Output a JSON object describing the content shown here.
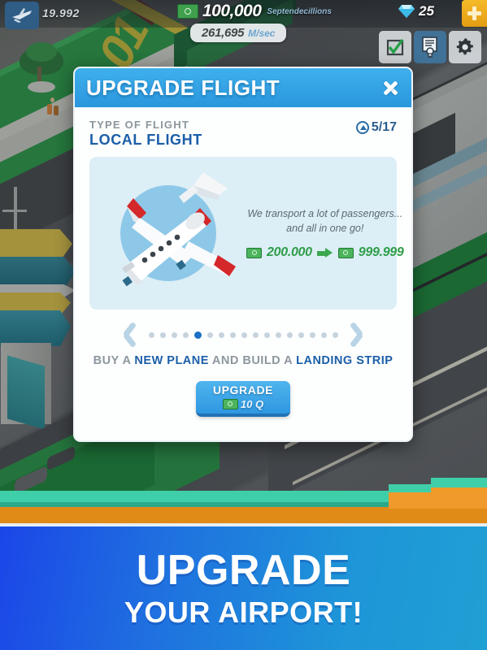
{
  "hud": {
    "plane_icon": "airplane-icon",
    "plane_count": "19.992",
    "cash_icon": "cash-icon",
    "money_value": "100,000",
    "money_unit": "Septendecillions",
    "rate_value": "261,695",
    "rate_unit": "M/sec",
    "gem_icon": "gem-icon",
    "gem_count": "25",
    "plus_icon": "plus-icon",
    "buttons": [
      {
        "name": "tasks-button",
        "icon": "checkmark-box-icon"
      },
      {
        "name": "missions-button",
        "icon": "certificate-icon"
      },
      {
        "name": "settings-button",
        "icon": "gear-icon"
      }
    ]
  },
  "modal": {
    "title": "UPGRADE FLIGHT",
    "close_icon": "close-icon",
    "type_label": "TYPE OF FLIGHT",
    "type_name": "LOCAL FLIGHT",
    "level_icon": "level-up-icon",
    "level_text": "5/17",
    "plane_art": "private-jet-illustration",
    "desc_line1": "We transport a lot of passengers...",
    "desc_line2": "and all in one go!",
    "cost_current": "200.000",
    "cost_next": "999.999",
    "arrow_icon": "arrow-right-icon",
    "prev_icon": "chevron-left-icon",
    "next_icon": "chevron-right-icon",
    "dots_total": 17,
    "dots_active": 5,
    "goal_prefix": "BUY A ",
    "goal_highlight1": "NEW PLANE",
    "goal_middle": " AND BUILD A ",
    "goal_highlight2": "LANDING STRIP",
    "upgrade_label": "UPGRADE",
    "upgrade_cost": "10 Q"
  },
  "banner": {
    "line1": "UPGRADE",
    "line2": "YOUR AIRPORT!"
  },
  "colors": {
    "header_blue": "#2a96dd",
    "accent_blue": "#1b5fa8",
    "money_green": "#2f9e4a",
    "banner_blue": "#1f6fe0",
    "gold": "#e39d12"
  }
}
